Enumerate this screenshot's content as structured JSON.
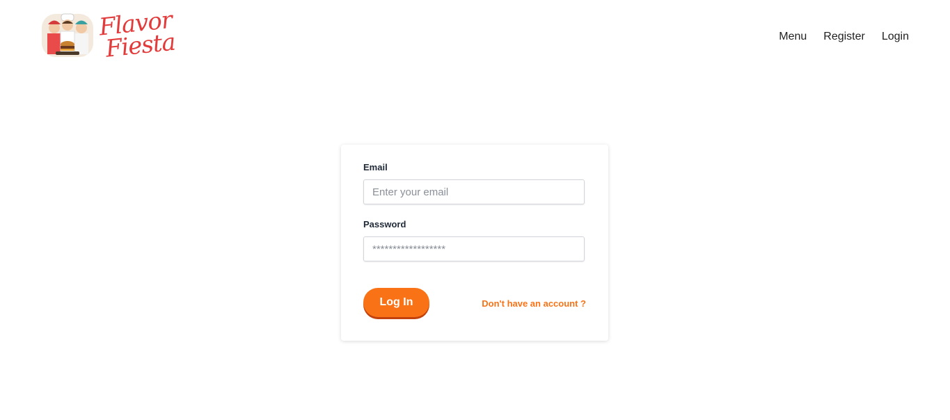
{
  "brand": {
    "line1": "Flavor",
    "line2": "Fiesta",
    "color": "#e23b3b"
  },
  "nav": {
    "menu": "Menu",
    "register": "Register",
    "login": "Login"
  },
  "form": {
    "email_label": "Email",
    "email_placeholder": "Enter your email",
    "email_value": "",
    "password_label": "Password",
    "password_placeholder": "******************",
    "password_value": "",
    "submit_label": "Log In",
    "signup_link": "Don't have an account ?",
    "accent_color": "#f97316"
  }
}
